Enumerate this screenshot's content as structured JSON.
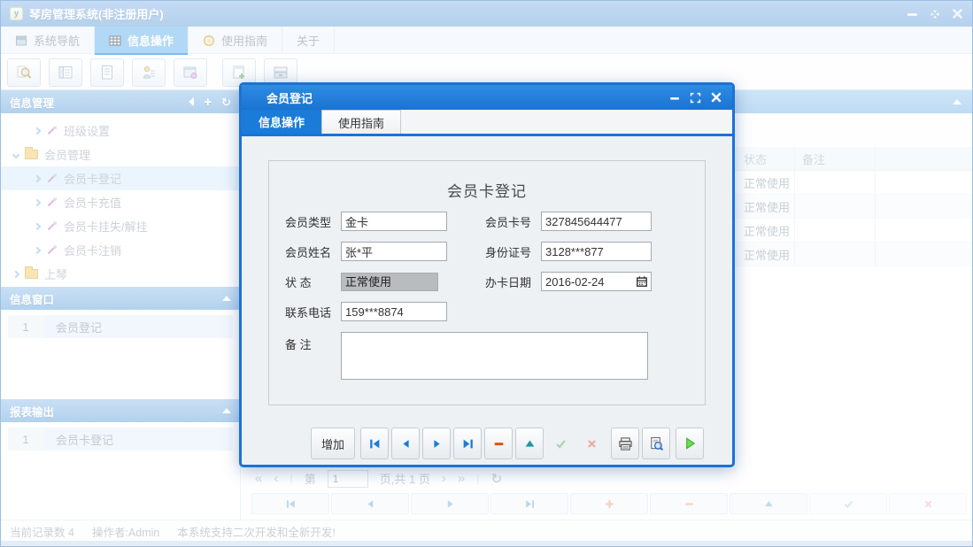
{
  "window": {
    "title": "琴房管理系统(非注册用户)",
    "controls": {
      "minimize": "minimize",
      "restore": "restore",
      "close": "close"
    }
  },
  "main_tabs": [
    {
      "label": "系统导航",
      "icon": "window-icon",
      "active": false
    },
    {
      "label": "信息操作",
      "icon": "grid-icon",
      "active": true
    },
    {
      "label": "使用指南",
      "icon": "guide-icon",
      "active": false
    },
    {
      "label": "关于",
      "icon": "",
      "active": false
    }
  ],
  "toolbar_icons": [
    "search-icon",
    "report-icon",
    "document-icon",
    "user-icon",
    "window-icon",
    "document-add-icon",
    "drawer-icon"
  ],
  "sidebar": {
    "panel_info_title": "信息管理",
    "panel_windows_title": "信息窗口",
    "panel_reports_title": "报表输出",
    "tree": {
      "items": [
        {
          "label": "班级设置"
        },
        {
          "label": "会员管理"
        },
        {
          "label": "会员卡登记"
        },
        {
          "label": "会员卡充值"
        },
        {
          "label": "会员卡挂失/解挂"
        },
        {
          "label": "会员卡注销"
        },
        {
          "label": "上琴"
        }
      ]
    },
    "info_windows": [
      {
        "index": "1",
        "label": "会员登记"
      }
    ],
    "report_outputs": [
      {
        "index": "1",
        "label": "会员卡登记"
      }
    ]
  },
  "content": {
    "table": {
      "headers": {
        "status": "状态",
        "remark": "备注"
      },
      "rows": [
        {
          "status": "正常使用",
          "remark": ""
        },
        {
          "status": "正常使用",
          "remark": ""
        },
        {
          "status": "正常使用",
          "remark": ""
        },
        {
          "status": "正常使用",
          "remark": ""
        }
      ]
    },
    "pagination": {
      "first": "«",
      "prev": "‹",
      "word_page": "第",
      "page_value": "1",
      "word_total": "页,共 1 页",
      "next": "›",
      "last": "»",
      "refresh": "↻"
    }
  },
  "status_bar": {
    "records": "当前记录数 4",
    "operator": "操作者:Admin",
    "note": "本系统支持二次开发和全新开发!"
  },
  "dialog": {
    "title": "会员登记",
    "tabs": [
      {
        "label": "信息操作",
        "active": true
      },
      {
        "label": "使用指南",
        "active": false
      }
    ],
    "form": {
      "title": "会员卡登记",
      "fields": {
        "member_type": {
          "label": "会员类型",
          "value": "金卡"
        },
        "card_no": {
          "label": "会员卡号",
          "value": "327845644477"
        },
        "member_name": {
          "label": "会员姓名",
          "value": "张*平"
        },
        "id_no": {
          "label": "身份证号",
          "value": "3128***877"
        },
        "status": {
          "label": "状 态",
          "value": "正常使用"
        },
        "issue_date": {
          "label": "办卡日期",
          "value": "2016-02-24"
        },
        "phone": {
          "label": "联系电话",
          "value": "159***8874"
        },
        "remark": {
          "label": "备 注",
          "value": ""
        }
      }
    },
    "footer": {
      "add_label": "增加",
      "icons": [
        "first-record-icon",
        "prev-record-icon",
        "next-record-icon",
        "last-record-icon",
        "delete-icon",
        "edit-icon",
        "confirm-icon",
        "cancel-icon",
        "print-icon",
        "print-preview-icon",
        "run-icon"
      ]
    }
  },
  "colors": {
    "accent_blue": "#1a7ad6",
    "dialog_border": "#1a73d4",
    "titlebar_blue": "#8fbbe8",
    "panel_header_blue": "#7cb1e2",
    "status_field_gray": "#b9bcbf",
    "delete_red": "#e8500f",
    "edit_teal": "#1e96a6",
    "run_green": "#5ad450"
  }
}
